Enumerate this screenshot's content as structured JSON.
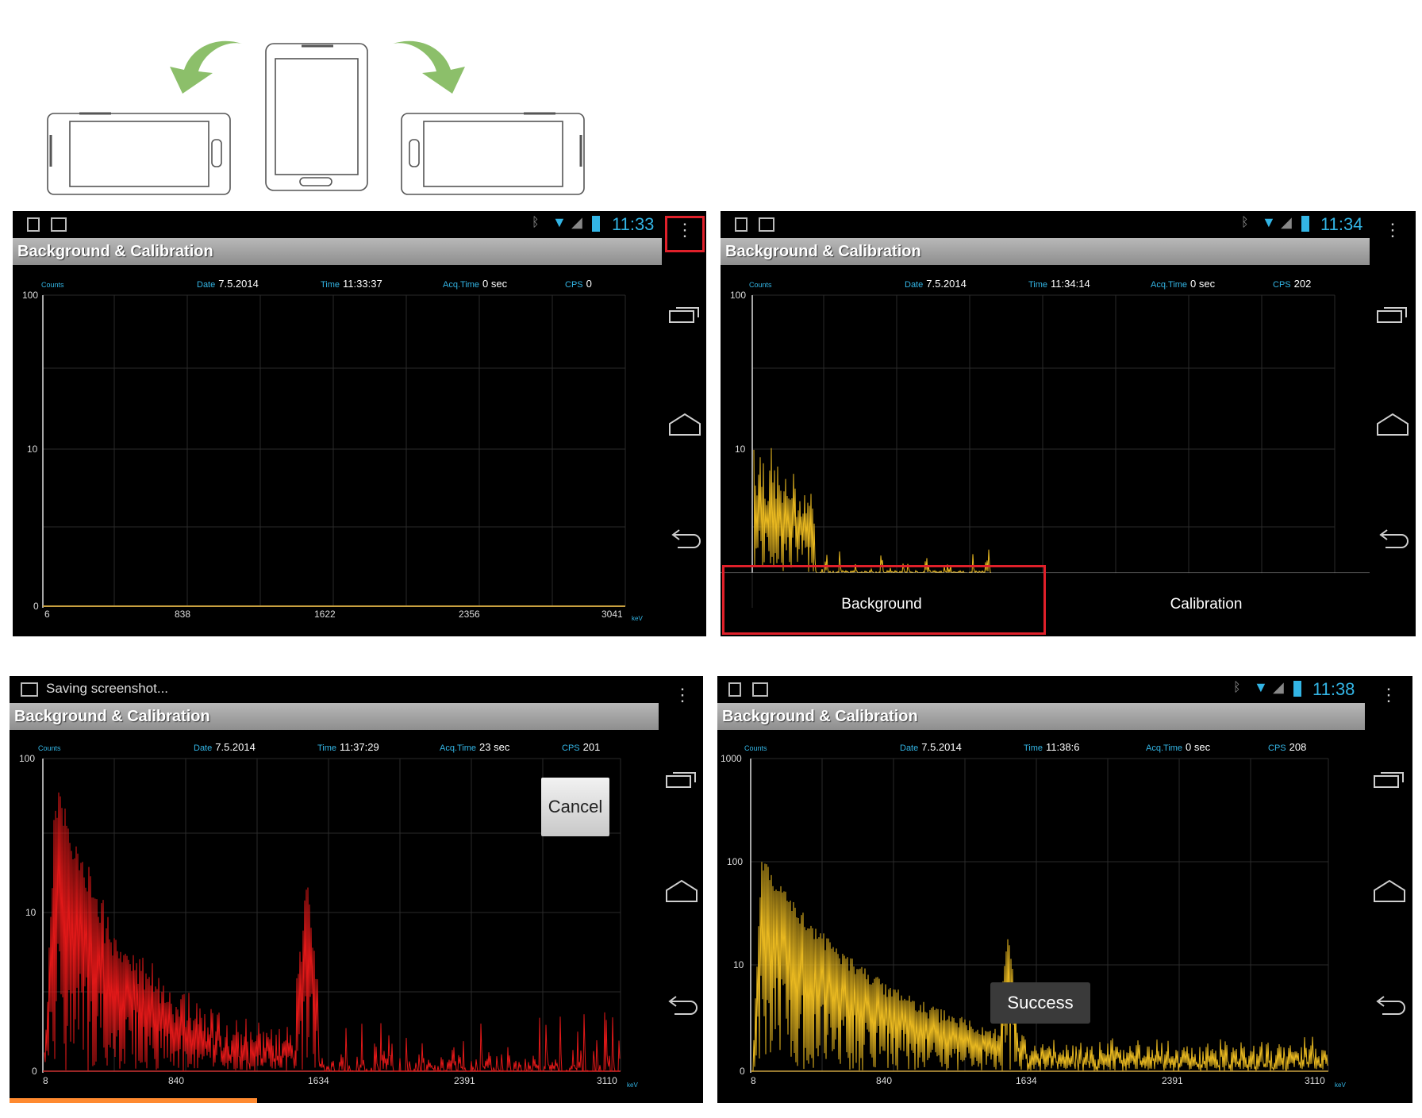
{
  "rotation": {
    "icons": [
      "phone-landscape-left-icon",
      "phone-portrait-icon",
      "phone-landscape-right-icon",
      "rotate-left-arrow-icon",
      "rotate-right-arrow-icon"
    ],
    "arrow_color": "#8cbf6a"
  },
  "app_title": "Background & Calibration",
  "labels": {
    "counts": "Counts",
    "date": "Date",
    "time": "Time",
    "acq_time": "Acq.Time",
    "cps": "CPS",
    "kev": "keV"
  },
  "screens": [
    {
      "status_time": "11:33",
      "header": {
        "date": "7.5.2014",
        "time": "11:33:37",
        "acq_time": "0 sec",
        "cps": "0"
      },
      "y_ticks": [
        "100",
        "10",
        "0"
      ],
      "x_ticks": [
        "6",
        "838",
        "1622",
        "2356",
        "3041"
      ]
    },
    {
      "status_time": "11:34",
      "header": {
        "date": "7.5.2014",
        "time": "11:34:14",
        "acq_time": "0 sec",
        "cps": "202"
      },
      "y_ticks": [
        "100",
        "10",
        "0"
      ],
      "x_ticks": [
        "6",
        "838",
        "1622",
        "2356",
        "3041"
      ],
      "menu": {
        "background": "Background",
        "calibration": "Calibration"
      }
    },
    {
      "status_note": "Saving screenshot...",
      "header": {
        "date": "7.5.2014",
        "time": "11:37:29",
        "acq_time": "23 sec",
        "cps": "201"
      },
      "y_ticks": [
        "100",
        "10",
        "0"
      ],
      "x_ticks": [
        "8",
        "840",
        "1634",
        "2391",
        "3110"
      ],
      "cancel_label": "Cancel"
    },
    {
      "status_time": "11:38",
      "header": {
        "date": "7.5.2014",
        "time": "11:38:6",
        "acq_time": "0 sec",
        "cps": "208"
      },
      "y_ticks": [
        "1000",
        "100",
        "10",
        "0"
      ],
      "x_ticks": [
        "8",
        "840",
        "1634",
        "2391",
        "3110"
      ],
      "toast": "Success"
    }
  ],
  "colors": {
    "accent": "#33b5e5",
    "spectrum_yellow": "#e8b820",
    "spectrum_red": "#e01818",
    "highlight_red": "#e0202a",
    "progress_orange": "#ff8a30"
  }
}
